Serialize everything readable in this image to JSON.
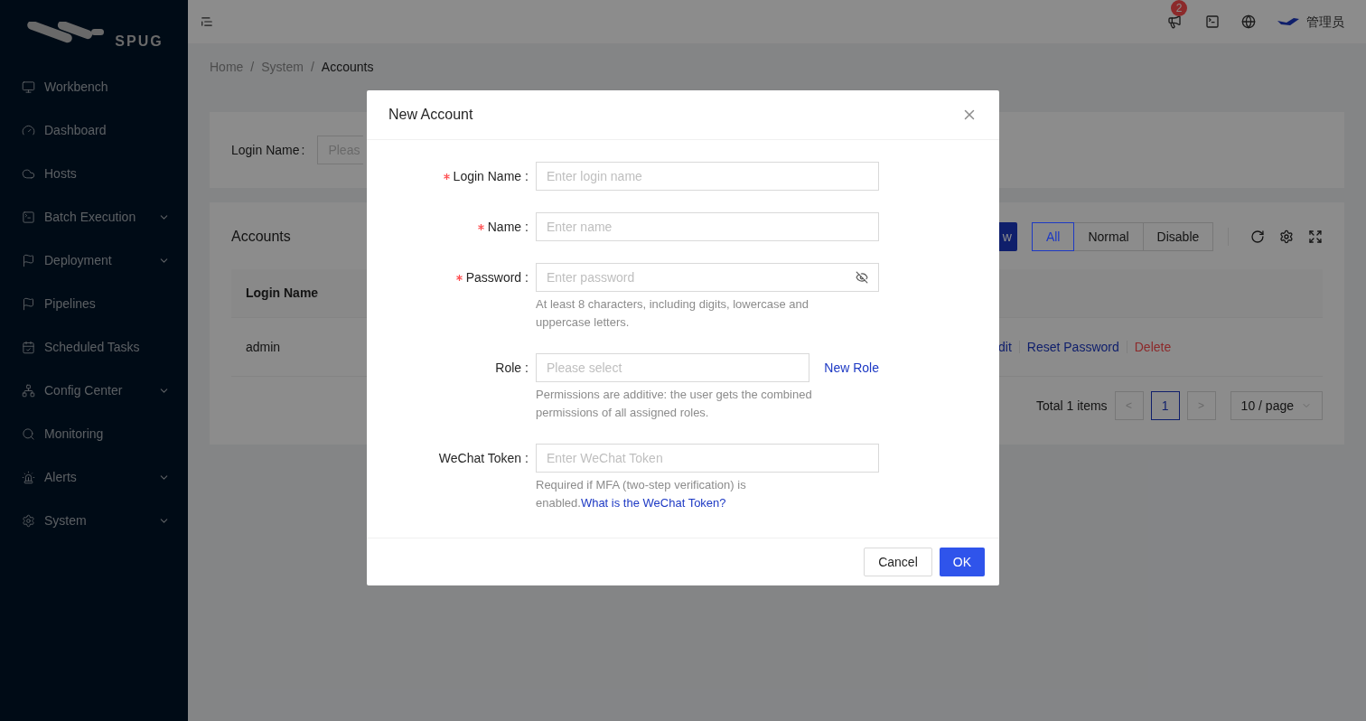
{
  "sidebar": {
    "brand": "SPUG",
    "items": [
      {
        "label": "Workbench",
        "has_submenu": false
      },
      {
        "label": "Dashboard",
        "has_submenu": false
      },
      {
        "label": "Hosts",
        "has_submenu": false
      },
      {
        "label": "Batch Execution",
        "has_submenu": true
      },
      {
        "label": "Deployment",
        "has_submenu": true
      },
      {
        "label": "Pipelines",
        "has_submenu": false
      },
      {
        "label": "Scheduled Tasks",
        "has_submenu": false
      },
      {
        "label": "Config Center",
        "has_submenu": true
      },
      {
        "label": "Monitoring",
        "has_submenu": false
      },
      {
        "label": "Alerts",
        "has_submenu": true
      },
      {
        "label": "System",
        "has_submenu": true
      }
    ]
  },
  "header": {
    "notification_count": "2",
    "user": "管理员"
  },
  "breadcrumb": [
    {
      "label": "Home"
    },
    {
      "separator": "/",
      "label": "System"
    },
    {
      "separator": "/",
      "label": "Accounts"
    }
  ],
  "filter": {
    "label": "Login Name",
    "colon": ":",
    "placeholder": "Pleas"
  },
  "accounts": {
    "title": "Accounts",
    "new_button": "w",
    "status_filter": [
      {
        "label": "All",
        "selected": true
      },
      {
        "label": "Normal",
        "selected": false
      },
      {
        "label": "Disable",
        "selected": false
      }
    ],
    "columns": [
      "Login Name"
    ],
    "rows": [
      {
        "login_name": "admin",
        "actions": [
          {
            "label": "dit",
            "kind": "link"
          },
          {
            "label": "Reset Password",
            "kind": "link"
          },
          {
            "label": "Delete",
            "kind": "danger"
          }
        ]
      }
    ],
    "total": "Total 1 items",
    "prev": "<",
    "next": ">",
    "pages": [
      {
        "label": "1",
        "selected": true
      }
    ],
    "page_size": "10 / page"
  },
  "modal": {
    "title": "New Account",
    "fields": [
      {
        "kind": "input",
        "label": "Login Name",
        "colon": ":",
        "required": true,
        "placeholder": "Enter login name"
      },
      {
        "kind": "input",
        "label": "Name",
        "colon": ":",
        "required": true,
        "placeholder": "Enter name"
      },
      {
        "kind": "password",
        "label": "Password",
        "colon": ":",
        "required": true,
        "placeholder": "Enter password",
        "help": "At least 8 characters, including digits, lowercase and uppercase letters."
      },
      {
        "kind": "select",
        "label": "Role",
        "colon": ":",
        "required": false,
        "placeholder": "Please select",
        "link": "New Role",
        "help": "Permissions are additive: the user gets the combined permissions of all assigned roles."
      },
      {
        "kind": "input",
        "label": "WeChat Token",
        "colon": ":",
        "required": false,
        "placeholder": "Enter WeChat Token",
        "help": "Required if MFA (two-step verification) is enabled.",
        "help_link": "What is the WeChat Token?"
      }
    ],
    "cancel": "Cancel",
    "ok": "OK"
  }
}
